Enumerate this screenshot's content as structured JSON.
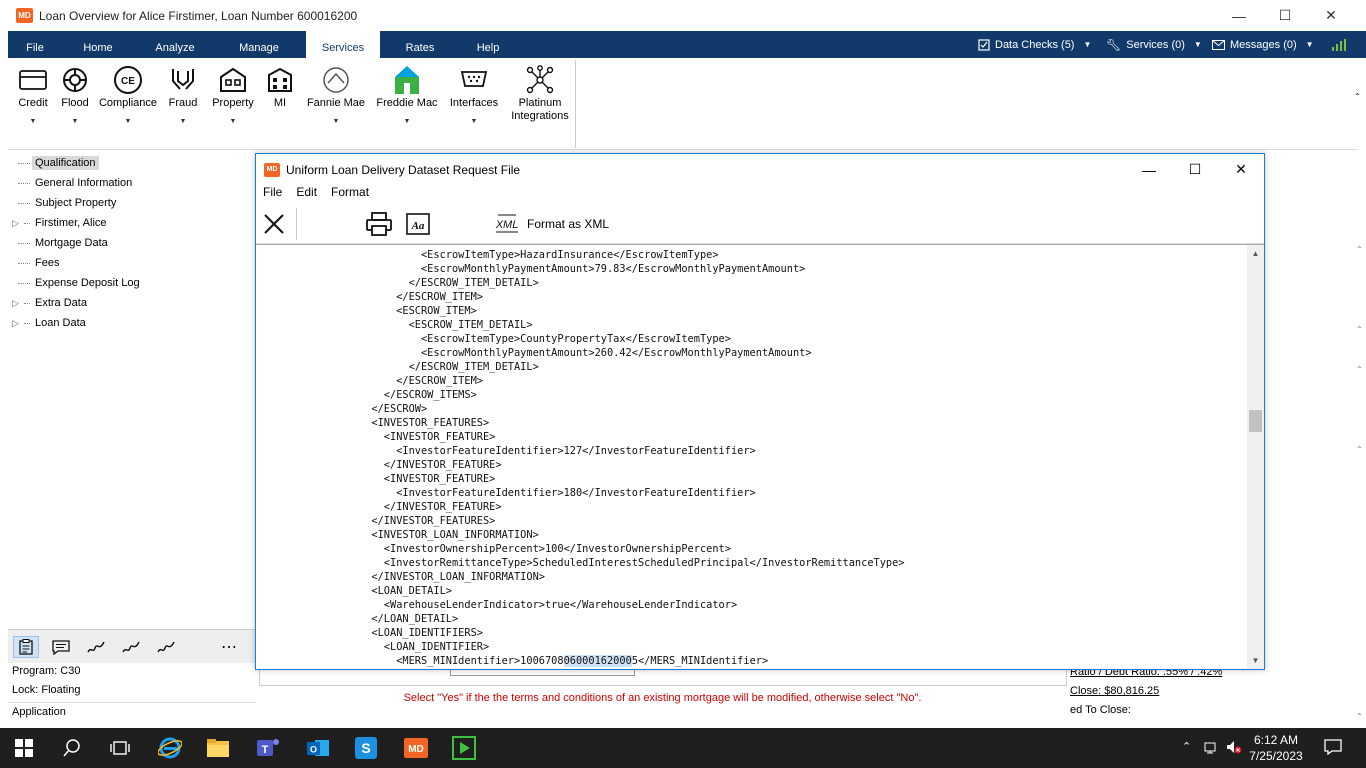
{
  "window": {
    "title": "Loan Overview for Alice Firstimer, Loan Number 600016200",
    "logo": "MD"
  },
  "ribbon_tabs": [
    "File",
    "Home",
    "Analyze",
    "Manage",
    "Services",
    "Rates",
    "Help"
  ],
  "active_tab": "Services",
  "ribbon_right": {
    "data_checks": "Data Checks (5)",
    "services": "Services (0)",
    "messages": "Messages (0)"
  },
  "ribbon_buttons": [
    {
      "label": "Credit",
      "icon": "credit-card-icon"
    },
    {
      "label": "Flood",
      "icon": "lifebuoy-icon"
    },
    {
      "label": "Compliance",
      "icon": "compliance-icon"
    },
    {
      "label": "Fraud",
      "icon": "hands-icon"
    },
    {
      "label": "Property",
      "icon": "property-icon"
    },
    {
      "label": "MI",
      "icon": "building-icon"
    },
    {
      "label": "Fannie Mae",
      "icon": "fannie-mae-icon"
    },
    {
      "label": "Freddie Mac",
      "icon": "freddie-mac-icon"
    },
    {
      "label": "Interfaces",
      "icon": "interfaces-icon"
    },
    {
      "label": "Platinum Integrations",
      "label_line1": "Platinum",
      "label_line2": "Integrations",
      "icon": "network-icon"
    }
  ],
  "tree": [
    {
      "label": "Qualification",
      "selected": true,
      "expandable": false
    },
    {
      "label": "General Information",
      "expandable": false
    },
    {
      "label": "Subject Property",
      "expandable": false
    },
    {
      "label": "Firstimer, Alice",
      "expandable": true
    },
    {
      "label": "Mortgage Data",
      "expandable": false
    },
    {
      "label": "Fees",
      "expandable": false
    },
    {
      "label": "Expense Deposit Log",
      "expandable": false
    },
    {
      "label": "Extra Data",
      "expandable": true
    },
    {
      "label": "Loan Data",
      "expandable": true
    }
  ],
  "left_info": {
    "program": "Program: C30",
    "lock": "Lock: Floating",
    "status": "Application"
  },
  "right_fragments": {
    "ratio": "Ratio / Debt Ratio: .55% / .42%",
    "close": "Close: $80,816.25",
    "to_close": "ed To Close:"
  },
  "dialog": {
    "title": "Uniform Loan Delivery Dataset Request File",
    "logo": "MD",
    "menu": [
      "File",
      "Edit",
      "Format"
    ],
    "format_xml_label": "Format as XML",
    "xml_icon_text": "XML",
    "xml_lines": [
      "                    <EscrowItemType>HazardInsurance</EscrowItemType>",
      "                    <EscrowMonthlyPaymentAmount>79.83</EscrowMonthlyPaymentAmount>",
      "                  </ESCROW_ITEM_DETAIL>",
      "                </ESCROW_ITEM>",
      "                <ESCROW_ITEM>",
      "                  <ESCROW_ITEM_DETAIL>",
      "                    <EscrowItemType>CountyPropertyTax</EscrowItemType>",
      "                    <EscrowMonthlyPaymentAmount>260.42</EscrowMonthlyPaymentAmount>",
      "                  </ESCROW_ITEM_DETAIL>",
      "                </ESCROW_ITEM>",
      "              </ESCROW_ITEMS>",
      "            </ESCROW>",
      "            <INVESTOR_FEATURES>",
      "              <INVESTOR_FEATURE>",
      "                <InvestorFeatureIdentifier>127</InvestorFeatureIdentifier>",
      "              </INVESTOR_FEATURE>",
      "              <INVESTOR_FEATURE>",
      "                <InvestorFeatureIdentifier>180</InvestorFeatureIdentifier>",
      "              </INVESTOR_FEATURE>",
      "            </INVESTOR_FEATURES>",
      "            <INVESTOR_LOAN_INFORMATION>",
      "              <InvestorOwnershipPercent>100</InvestorOwnershipPercent>",
      "              <InvestorRemittanceType>ScheduledInterestScheduledPrincipal</InvestorRemittanceType>",
      "            </INVESTOR_LOAN_INFORMATION>",
      "            <LOAN_DETAIL>",
      "              <WarehouseLenderIndicator>true</WarehouseLenderIndicator>",
      "            </LOAN_DETAIL>",
      "            <LOAN_IDENTIFIERS>",
      "              <LOAN_IDENTIFIER>"
    ],
    "last_line": {
      "before": "                <MERS_MINIdentifier>1006708",
      "highlight": "06000162000",
      "after": "5</MERS_MINIdentifier>"
    },
    "scroll_position": 0.4
  },
  "status_message": "Select  \"Yes\" if the the terms and conditions of an existing mortgage will be modified, otherwise select \"No\".",
  "taskbar": {
    "time": "6:12 AM",
    "date": "7/25/2023",
    "md_label": "MD"
  },
  "colors": {
    "ribbon": "#113a6b",
    "accent": "#f26522",
    "error": "#d00000",
    "taskbar": "#1f1f1f"
  }
}
